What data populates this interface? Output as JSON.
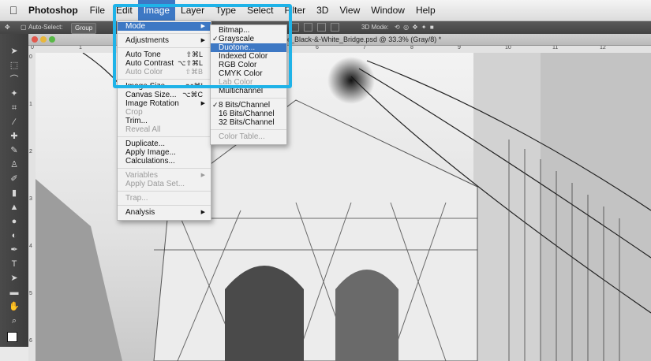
{
  "menubar": {
    "apple_icon": "apple-icon",
    "app": "Photoshop",
    "items": [
      "File",
      "Edit",
      "Image",
      "Layer",
      "Type",
      "Select",
      "Filter",
      "3D",
      "View",
      "Window",
      "Help"
    ],
    "active": "Image"
  },
  "options_bar": {
    "auto_select_label": "Auto-Select:",
    "auto_select_value": "Group",
    "mode_label": "3D Mode:"
  },
  "document": {
    "title": "or_Black-&-White_Bridge.psd @ 33.3% (Gray/8) *"
  },
  "ruler": {
    "top_labels": [
      "0",
      "1",
      "6",
      "7",
      "8",
      "9",
      "10",
      "11",
      "12"
    ],
    "left_labels": [
      "0",
      "1",
      "2",
      "3",
      "4",
      "5",
      "6"
    ]
  },
  "image_menu": {
    "items": [
      {
        "label": "Mode",
        "submenu": true,
        "highlighted": true
      },
      {
        "sep": true
      },
      {
        "label": "Adjustments",
        "submenu": true
      },
      {
        "sep": true
      },
      {
        "label": "Auto Tone",
        "shortcut": "⇧⌘L"
      },
      {
        "label": "Auto Contrast",
        "shortcut": "⌥⇧⌘L"
      },
      {
        "label": "Auto Color",
        "shortcut": "⇧⌘B",
        "disabled": true
      },
      {
        "sep": true
      },
      {
        "label": "Image Size...",
        "shortcut": "⌥⌘I"
      },
      {
        "label": "Canvas Size...",
        "shortcut": "⌥⌘C"
      },
      {
        "label": "Image Rotation",
        "submenu": true
      },
      {
        "label": "Crop",
        "disabled": true
      },
      {
        "label": "Trim..."
      },
      {
        "label": "Reveal All",
        "disabled": true
      },
      {
        "sep": true
      },
      {
        "label": "Duplicate..."
      },
      {
        "label": "Apply Image..."
      },
      {
        "label": "Calculations..."
      },
      {
        "sep": true
      },
      {
        "label": "Variables",
        "submenu": true,
        "disabled": true
      },
      {
        "label": "Apply Data Set...",
        "disabled": true
      },
      {
        "sep": true
      },
      {
        "label": "Trap...",
        "disabled": true
      },
      {
        "sep": true
      },
      {
        "label": "Analysis",
        "submenu": true
      }
    ]
  },
  "mode_submenu": {
    "items": [
      {
        "label": "Bitmap..."
      },
      {
        "label": "Grayscale",
        "checked": true
      },
      {
        "label": "Duotone...",
        "highlighted": true
      },
      {
        "label": "Indexed Color"
      },
      {
        "label": "RGB Color"
      },
      {
        "label": "CMYK Color"
      },
      {
        "label": "Lab Color",
        "disabled": true
      },
      {
        "label": "Multichannel"
      },
      {
        "sep": true
      },
      {
        "label": "8 Bits/Channel",
        "checked": true
      },
      {
        "label": "16 Bits/Channel"
      },
      {
        "label": "32 Bits/Channel"
      },
      {
        "sep": true
      },
      {
        "label": "Color Table...",
        "disabled": true
      }
    ]
  },
  "colors": {
    "menu_highlight": "#3d78c4",
    "callout_frame": "#1fb3e8"
  }
}
